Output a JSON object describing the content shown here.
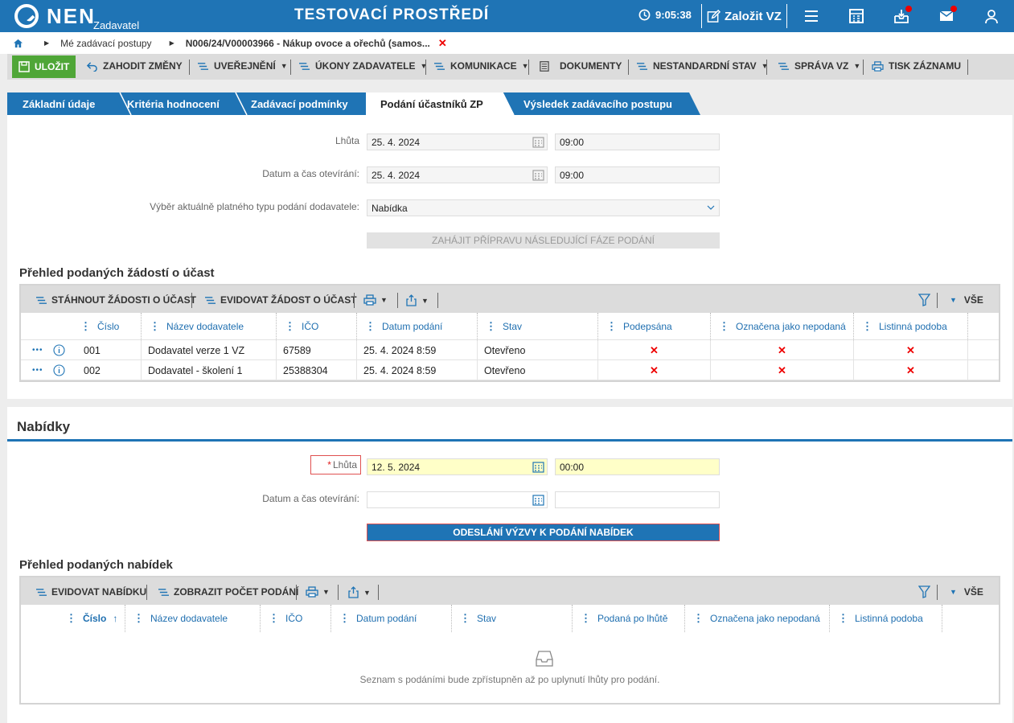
{
  "header": {
    "logo": "NEN",
    "logo_sub": "Zadavatel",
    "env_title": "TESTOVACÍ PROSTŘEDÍ",
    "clock": "9:05:38",
    "create_label": "Založit VZ"
  },
  "breadcrumb": {
    "item1": "Mé zadávací postupy",
    "item2": "N006/24/V00003966 - Nákup ovoce a ořechů (samos...",
    "close": "✕"
  },
  "toolbar": {
    "save": "ULOŽIT",
    "discard": "ZAHODIT ZMĚNY",
    "publish": "UVEŘEJNĚNÍ",
    "actions": "ÚKONY ZADAVATELE",
    "communication": "KOMUNIKACE",
    "documents": "DOKUMENTY",
    "nonstandard": "NESTANDARDNÍ STAV",
    "management": "SPRÁVA VZ",
    "print": "TISK ZÁZNAMU"
  },
  "tabs": [
    {
      "label": "Základní údaje"
    },
    {
      "label": "Kritéria hodnocení"
    },
    {
      "label": "Zadávací podmínky"
    },
    {
      "label": "Podání účastníků ZP"
    },
    {
      "label": "Výsledek zadávacího postupu"
    }
  ],
  "applications": {
    "deadline_label": "Lhůta",
    "deadline_date": "25. 4. 2024",
    "deadline_time": "09:00",
    "opening_label": "Datum a čas otevírání:",
    "opening_date": "25. 4. 2024",
    "opening_time": "09:00",
    "type_label": "Výběr aktuálně platného typu podání dodavatele:",
    "type_value": "Nabídka",
    "next_phase_button": "ZAHÁJIT PŘÍPRAVU NÁSLEDUJÍCÍ FÁZE PODÁNÍ",
    "overview_title": "Přehled podaných žádostí o účast",
    "grid_toolbar": {
      "download": "STÁHNOUT ŽÁDOSTI O ÚČAST",
      "register": "EVIDOVAT ŽÁDOST O ÚČAST",
      "all": "VŠE"
    },
    "columns": [
      "Číslo",
      "Název dodavatele",
      "IČO",
      "Datum podání",
      "Stav",
      "Podepsána",
      "Označena jako nepodaná",
      "Listinná podoba"
    ],
    "rows": [
      {
        "number": "001",
        "supplier": "Dodavatel verze 1 VZ",
        "ico": "67589",
        "date": "25. 4. 2024 8:59",
        "state": "Otevřeno",
        "signed": "✕",
        "unsubmitted": "✕",
        "paper": "✕"
      },
      {
        "number": "002",
        "supplier": "Dodavatel - školení 1",
        "ico": "25388304",
        "date": "25. 4. 2024 8:59",
        "state": "Otevřeno",
        "signed": "✕",
        "unsubmitted": "✕",
        "paper": "✕"
      }
    ]
  },
  "offers": {
    "title": "Nabídky",
    "deadline_required": "*",
    "deadline_label": "Lhůta",
    "deadline_date": "12. 5. 2024",
    "deadline_time": "00:00",
    "opening_label": "Datum a čas otevírání:",
    "opening_date": "",
    "opening_time": "",
    "send_button": "ODESLÁNÍ VÝZVY K PODÁNÍ NABÍDEK",
    "overview_title": "Přehled podaných nabídek",
    "grid_toolbar": {
      "register": "EVIDOVAT NABÍDKU",
      "count": "ZOBRAZIT POČET PODÁNÍ",
      "all": "VŠE"
    },
    "columns": [
      "Číslo",
      "Název dodavatele",
      "IČO",
      "Datum podání",
      "Stav",
      "Podaná po lhůtě",
      "Označena jako nepodaná",
      "Listinná podoba"
    ],
    "sort_indicator": "↑",
    "empty_message": "Seznam s podáními bude zpřístupněn až po uplynutí lhůty pro podání."
  },
  "colors": {
    "primary": "#1f74b5",
    "save_green": "#4fa637",
    "required_red": "#e02020",
    "highlight_yellow": "#ffffc8"
  }
}
